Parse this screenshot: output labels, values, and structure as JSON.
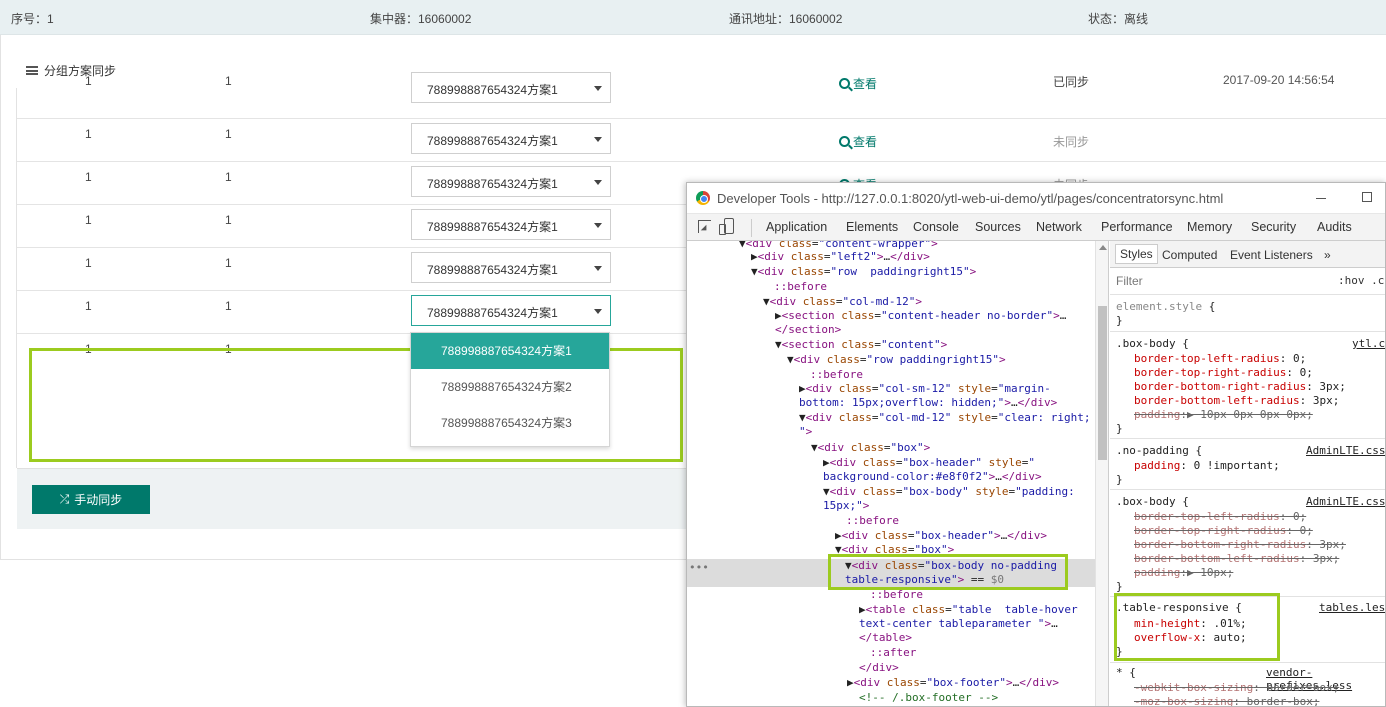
{
  "infobar": {
    "serial": "序号：1",
    "concentrator": "集中器：16060002",
    "address": "通讯地址：16060002",
    "status_label": "状态：",
    "status_value": "离线"
  },
  "section_title": "分组方案同步",
  "rows": [
    {
      "a": "1",
      "b": "1",
      "plan": "788998887654324方案1",
      "view": "查看",
      "status": "已同步",
      "time": "2017-09-20 14:56:54"
    },
    {
      "a": "1",
      "b": "1",
      "plan": "788998887654324方案1",
      "view": "查看",
      "status": "未同步",
      "time": ""
    },
    {
      "a": "1",
      "b": "1",
      "plan": "788998887654324方案1",
      "view": "查看",
      "status": "未同步",
      "time": ""
    },
    {
      "a": "1",
      "b": "1",
      "plan": "788998887654324方案1",
      "view": "",
      "status": "",
      "time": ""
    },
    {
      "a": "1",
      "b": "1",
      "plan": "788998887654324方案1",
      "view": "",
      "status": "",
      "time": ""
    },
    {
      "a": "1",
      "b": "1",
      "plan": "788998887654324方案1",
      "view": "",
      "status": "",
      "time": ""
    },
    {
      "a": "1",
      "b": "1",
      "plan": "",
      "view": "",
      "status": "",
      "time": ""
    }
  ],
  "dropdown_options": [
    "788998887654324方案1",
    "788998887654324方案2",
    "788998887654324方案3"
  ],
  "sync_button": "手动同步",
  "devtools": {
    "title": "Developer Tools - http://127.0.0.1:8020/ytl-web-ui-demo/ytl/pages/concentratorsync.html",
    "tabs": [
      "Application",
      "Elements",
      "Console",
      "Sources",
      "Network",
      "Performance",
      "Memory",
      "Security",
      "Audits"
    ],
    "style_tabs": [
      "Styles",
      "Computed",
      "Event Listeners",
      "»"
    ],
    "filter": "Filter",
    "hov": ":hov  .c"
  },
  "colors": {
    "accent": "#00796b",
    "dropdown_selected": "#26a69a",
    "highlight": "#9ccb1f",
    "offline": "#dd2c00"
  }
}
